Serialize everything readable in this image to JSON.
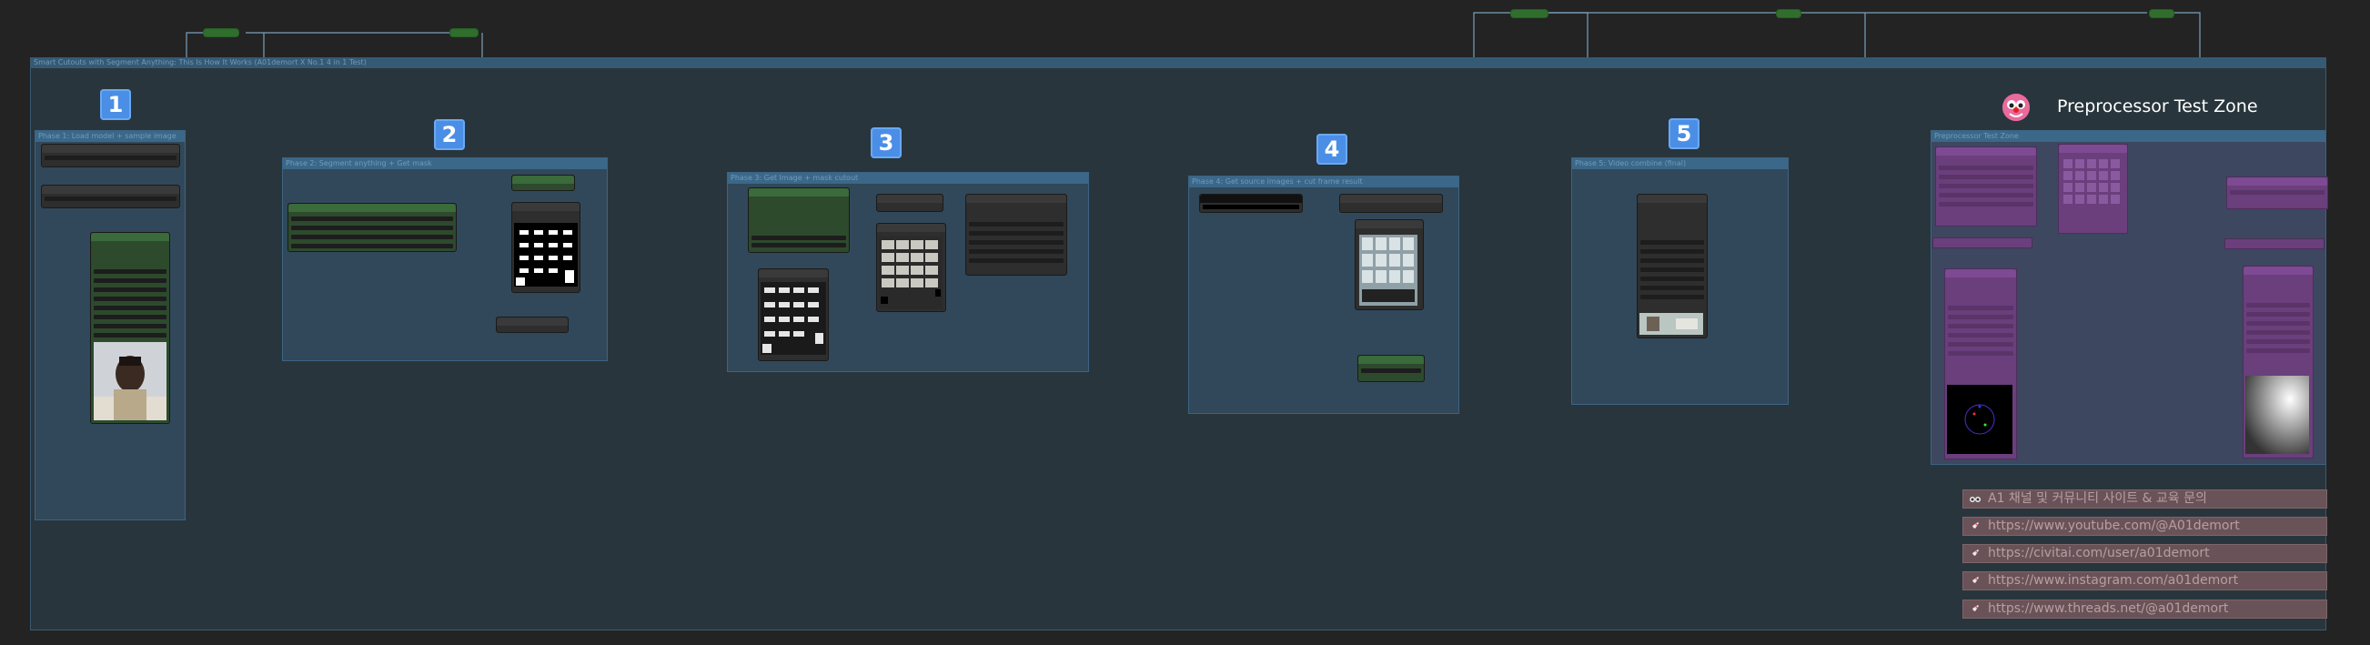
{
  "workflow": {
    "outer_title": "Smart Cutouts with Segment Anything: This Is How It Works (A01demort X No.1 4 in 1 Test)",
    "phases": [
      {
        "badge": "1",
        "title": "Phase 1: Load model + sample image"
      },
      {
        "badge": "2",
        "title": "Phase 2: Segment anything + Get mask"
      },
      {
        "badge": "3",
        "title": "Phase 3: Get Image + mask cutout"
      },
      {
        "badge": "4",
        "title": "Phase 4: Get source images + cut frame result"
      },
      {
        "badge": "5",
        "title": "Phase 5: Video combine (final)"
      }
    ],
    "preprocessor": {
      "heading": "Preprocessor Test Zone",
      "group_title": "Preprocessor Test Zone"
    },
    "links": {
      "header": "A1 채널 및 커뮤니티 사이트 & 교육 문의",
      "items": [
        "https://www.youtube.com/@A01demort",
        "https://civitai.com/user/a01demort",
        "https://www.instagram.com/a01demort",
        "https://www.threads.net/@a01demort"
      ]
    },
    "colors": {
      "canvas": "#232323",
      "group": "#31485a",
      "badge": "#4b8ee6",
      "link_row": "#6a5358",
      "wire": "#8ab6d6",
      "preprocessor_node": "#6a3f7c"
    }
  }
}
